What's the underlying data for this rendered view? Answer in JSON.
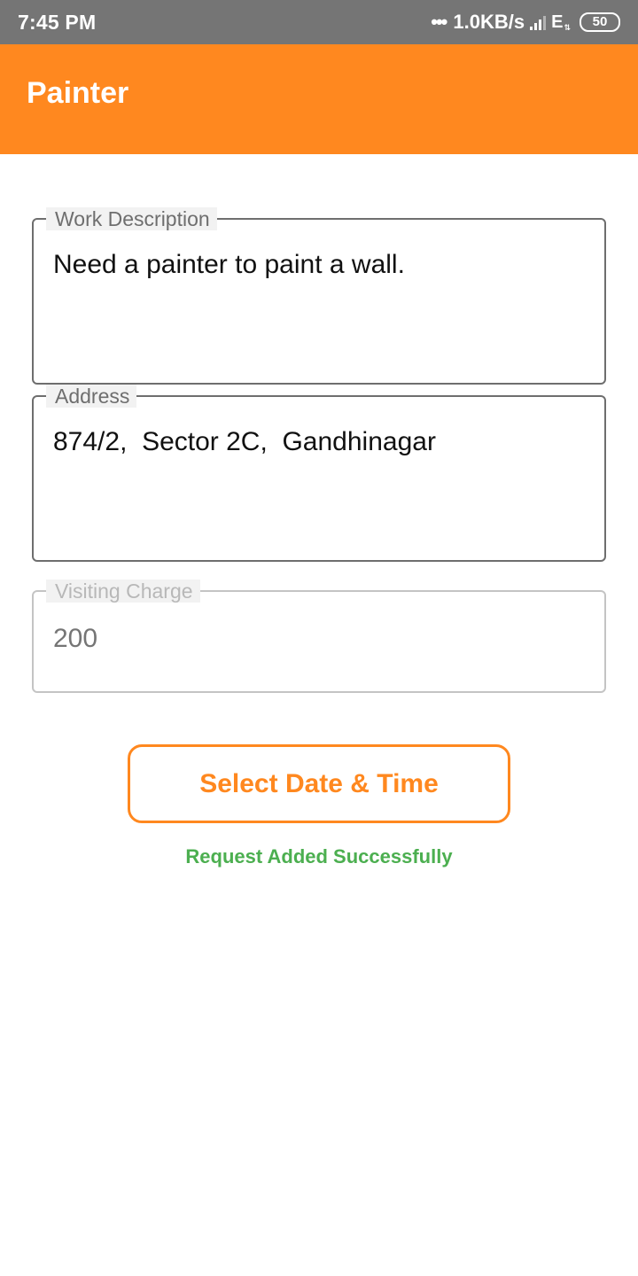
{
  "status_bar": {
    "time": "7:45 PM",
    "dots": "•••",
    "speed": "1.0KB/s",
    "network_type": "E",
    "battery": "50"
  },
  "app_bar": {
    "title": "Painter"
  },
  "form": {
    "work_description": {
      "label": "Work Description",
      "value": "Need a painter to paint a wall."
    },
    "address": {
      "label": "Address",
      "value": "874/2,  Sector 2C,  Gandhinagar"
    },
    "visiting_charge": {
      "label": "Visiting Charge",
      "value": "200"
    }
  },
  "actions": {
    "select_date_time_label": "Select Date & Time"
  },
  "status_message": "Request Added Successfully",
  "colors": {
    "accent": "#FF881F",
    "success": "#4CAF50",
    "status_bar": "#757575"
  }
}
